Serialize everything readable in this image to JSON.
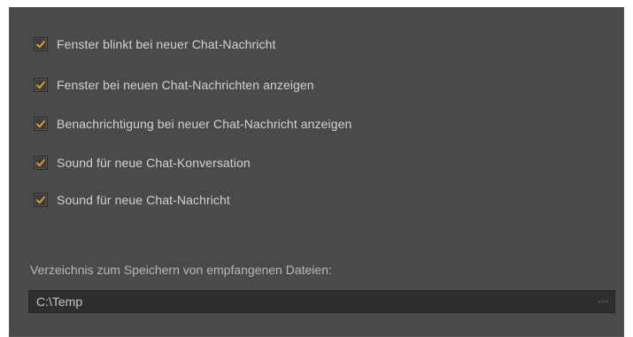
{
  "notifications": {
    "items": [
      {
        "label": "Fenster blinkt bei neuer Chat-Nachricht",
        "checked": true
      },
      {
        "label": "Fenster bei neuen Chat-Nachrichten anzeigen",
        "checked": true
      },
      {
        "label": "Benachrichtigung bei neuer Chat-Nachricht anzeigen",
        "checked": true
      },
      {
        "label": "Sound für neue Chat-Konversation",
        "checked": true
      },
      {
        "label": "Sound für neue Chat-Nachricht",
        "checked": true
      }
    ]
  },
  "download_dir": {
    "label": "Verzeichnis zum Speichern von empfangenen Dateien:",
    "value": "C:\\Temp",
    "browse_label": "···"
  },
  "colors": {
    "panel_bg": "#4a4a4a",
    "checkmark": "#f0a020",
    "text": "#d2d2d2",
    "field_bg": "#2e2e2e"
  },
  "icons": {
    "checkbox_mark": "checkmark-icon"
  }
}
